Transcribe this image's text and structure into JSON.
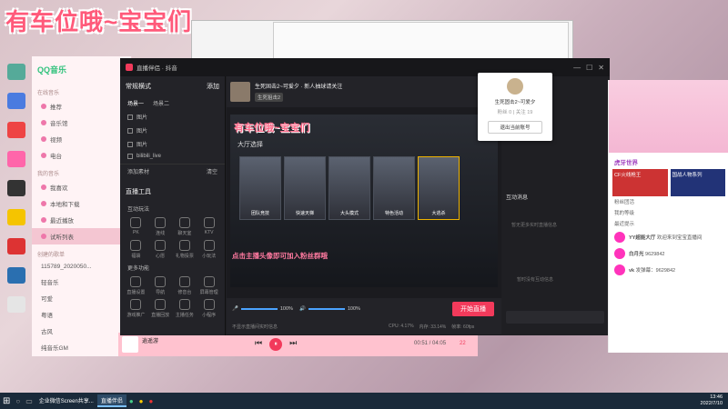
{
  "overlay": {
    "title": "有车位哦~宝宝们"
  },
  "desktop": {
    "icons": [
      "",
      "",
      "",
      "",
      "",
      "",
      "",
      "",
      "",
      ""
    ]
  },
  "qqmusic": {
    "logo": "QQ音乐",
    "section1": "在线音乐",
    "items": [
      "推荐",
      "音乐馆",
      "视频",
      "电台"
    ],
    "section2": "我的音乐",
    "items2": [
      "我喜欢",
      "本地和下载",
      "最近播放",
      "试听列表"
    ],
    "section3": "创建的歌单",
    "lists": [
      "115789_2020050...",
      "轻音乐",
      "可爱",
      "粤语",
      "古风",
      "纯音乐GM"
    ]
  },
  "player": {
    "song": "逍遥游",
    "time": "00:51 / 04:05",
    "count": "22"
  },
  "app": {
    "name": "直播伴侣 · 抖音",
    "streamer": "生死固击2~可爱夕",
    "status": "新人抽球请关注",
    "badge": "生死狙击2",
    "left": {
      "mode_title": "常规横式",
      "add": "添加",
      "tabs": [
        "场景一",
        "场景二"
      ],
      "layers": [
        "图片",
        "图片",
        "图片",
        "bilibili_live"
      ],
      "add_material": "添加素材",
      "clear": "清空",
      "tools_title": "直播工具",
      "interact": "互动玩法",
      "tools": [
        "PK",
        "连线",
        "聊天室",
        "KTV",
        "福袋",
        "心愿",
        "礼物投票",
        "小玩法"
      ],
      "more": "更多功能",
      "tools2": [
        "直播设置",
        "导航",
        "修音台",
        "屏幕管理",
        "游戏推广",
        "直播回放",
        "主播任务",
        "小程序"
      ]
    },
    "preview": {
      "title": "有车位哦~宝宝们",
      "hall": "大厅选择",
      "modes": [
        "团队竞技",
        "快速天梯",
        "大头模式",
        "特色活动",
        "大逃杀"
      ],
      "caption": "点击主播头像即可加入粉丝群哦"
    },
    "controls": {
      "mic": "100%",
      "speaker": "100%",
      "start": "开始直播",
      "tip": "不显示直播间实时信息",
      "cpu": "CPU: 4.17%",
      "mem": "内存: 33.14%",
      "fps": "帧率: 60fps"
    },
    "right": {
      "interact_title": "互动消息",
      "empty1": "暂无更多实时直播信息",
      "empty2": "暂时没有互动信息"
    }
  },
  "popup": {
    "name": "生死固击2~可爱夕",
    "stats": "粉丝 0 | 关注 19",
    "link": "退出当前账号"
  },
  "chat": {
    "tabs": [
      "虎牙世界"
    ],
    "banner1": "CF火线枪王",
    "banner2": "国战人物系列",
    "lines": [
      "粉丝团活",
      "我的等级",
      "最近提示"
    ],
    "messages": [
      {
        "user": "YY超能大厅",
        "text": "欢迎来到宝宝直播间"
      },
      {
        "user": "白月光",
        "text": "9629842"
      },
      {
        "user": "vk",
        "text": "发弹幕：9629842"
      }
    ]
  },
  "taskbar": {
    "items": [
      "企业微信Screen共享...",
      "直播伴侣"
    ],
    "time": "13:46",
    "date": "2022/7/10"
  }
}
